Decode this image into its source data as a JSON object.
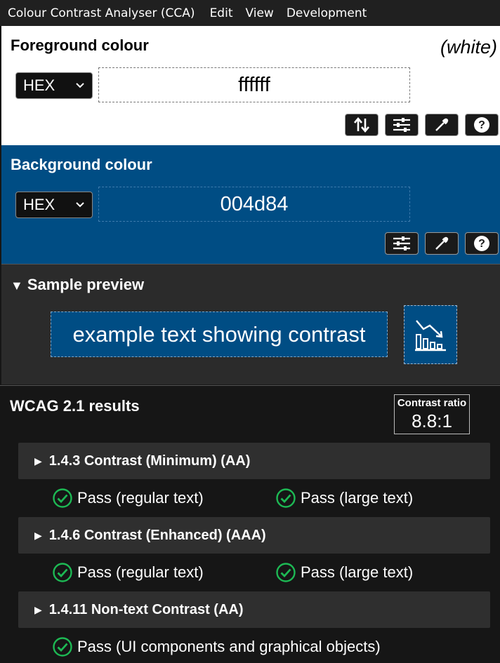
{
  "menu": {
    "app": "Colour Contrast Analyser (CCA)",
    "items": [
      "Edit",
      "View",
      "Development"
    ]
  },
  "foreground": {
    "title": "Foreground colour",
    "name": "(white)",
    "format": "HEX",
    "value": "ffffff",
    "color": "#ffffff",
    "tools": [
      "swap-icon",
      "sliders-icon",
      "eyedropper-icon",
      "help-icon"
    ]
  },
  "background": {
    "title": "Background colour",
    "format": "HEX",
    "value": "004d84",
    "color": "#004d84",
    "tools": [
      "sliders-icon",
      "eyedropper-icon",
      "help-icon"
    ]
  },
  "preview": {
    "title": "Sample preview",
    "sample_text": "example text showing contrast"
  },
  "results": {
    "title": "WCAG 2.1 results",
    "ratio_label": "Contrast ratio",
    "ratio_value": "8.8:1",
    "criteria": [
      {
        "label": "1.4.3 Contrast (Minimum) (AA)",
        "passes": [
          "Pass (regular text)",
          "Pass (large text)"
        ]
      },
      {
        "label": "1.4.6 Contrast (Enhanced) (AAA)",
        "passes": [
          "Pass (regular text)",
          "Pass (large text)"
        ]
      },
      {
        "label": "1.4.11 Non-text Contrast (AA)",
        "passes": [
          "Pass (UI components and graphical objects)"
        ]
      }
    ],
    "pass_color": "#1db954"
  }
}
